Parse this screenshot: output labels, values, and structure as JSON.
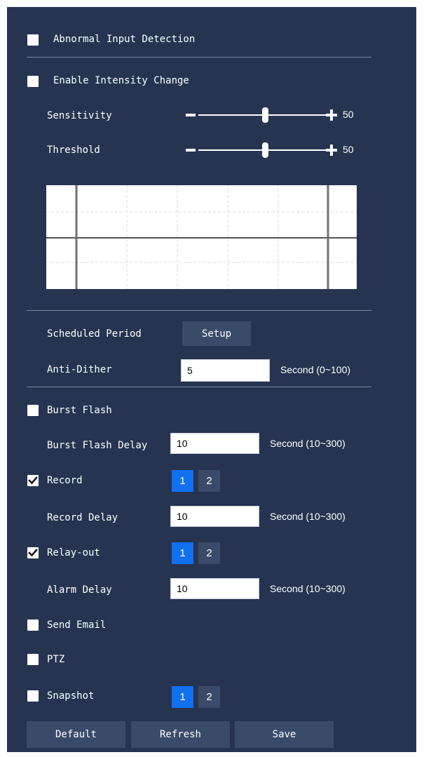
{
  "abnormal_input": {
    "label": "Abnormal Input Detection",
    "checked": false
  },
  "intensity": {
    "label": "Enable Intensity Change",
    "checked": false
  },
  "sensitivity": {
    "label": "Sensitivity",
    "value": "50"
  },
  "threshold": {
    "label": "Threshold",
    "value": "50"
  },
  "schedule": {
    "label": "Scheduled Period",
    "button": "Setup"
  },
  "anti_dither": {
    "label": "Anti-Dither",
    "value": "5",
    "unit": "Second (0~100)"
  },
  "burst_flash": {
    "label": "Burst Flash",
    "checked": false
  },
  "burst_flash_delay": {
    "label": "Burst Flash Delay",
    "value": "10",
    "unit": "Second (10~300)"
  },
  "record": {
    "label": "Record",
    "checked": true,
    "channels": [
      "1",
      "2"
    ],
    "active": "1"
  },
  "record_delay": {
    "label": "Record Delay",
    "value": "10",
    "unit": "Second (10~300)"
  },
  "relay_out": {
    "label": "Relay-out",
    "checked": true,
    "channels": [
      "1",
      "2"
    ],
    "active": "1"
  },
  "alarm_delay": {
    "label": "Alarm Delay",
    "value": "10",
    "unit": "Second (10~300)"
  },
  "send_email": {
    "label": "Send Email",
    "checked": false
  },
  "ptz": {
    "label": "PTZ",
    "checked": false
  },
  "snapshot": {
    "label": "Snapshot",
    "checked": false,
    "channels": [
      "1",
      "2"
    ],
    "active": "1"
  },
  "footer": {
    "default": "Default",
    "refresh": "Refresh",
    "save": "Save"
  },
  "colors": {
    "panel": "#263451",
    "button": "#3a4a69",
    "active_channel": "#1170f0"
  }
}
